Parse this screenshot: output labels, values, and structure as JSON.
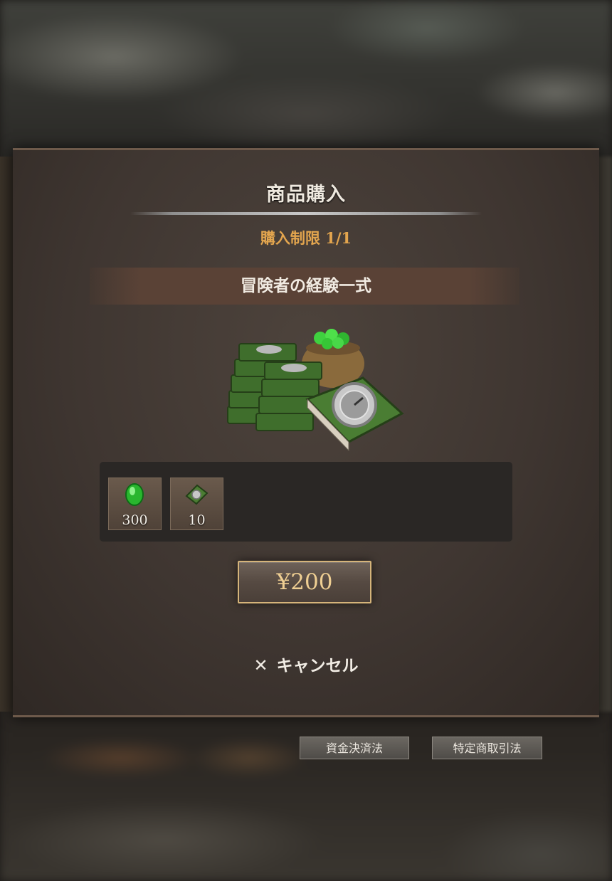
{
  "dialog": {
    "title": "商品購入",
    "purchase_limit": "購入制限 1/1",
    "product_name": "冒険者の経験一式",
    "items": [
      {
        "icon": "green-gem-icon",
        "quantity": "300"
      },
      {
        "icon": "green-book-icon",
        "quantity": "10"
      }
    ],
    "price_label": "¥200",
    "cancel_label": "キャンセル",
    "cancel_icon": "close-icon"
  },
  "footer": {
    "funds_settlement_label": "資金決済法",
    "commercial_transactions_label": "特定商取引法"
  },
  "colors": {
    "limit_text": "#e3a54e",
    "price_text": "#efcf93",
    "price_border": "#d5b47a"
  }
}
